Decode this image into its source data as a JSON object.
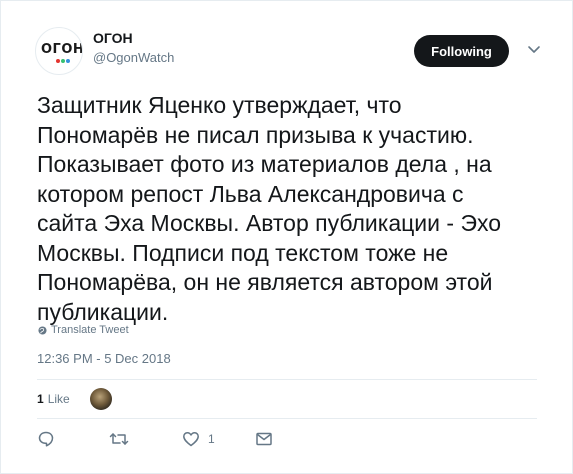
{
  "account": {
    "display_name": "ОГОН",
    "screen_name": "@OgonWatch",
    "avatar_text": "ОГОН"
  },
  "header": {
    "follow_label": "Following"
  },
  "tweet": {
    "text": "Защитник Яценко утверждает, что\nПономарёв не писал призыва к участию.\nПоказывает фото из материалов дела , на\nкотором репост Льва Александровича с\nсайта Эха Москвы. Автор публикации - Эхо\nМосквы. Подписи под текстом тоже не\nПономарёва, он не является автором этой\nпубликации.",
    "translate_label": "Translate Tweet",
    "timestamp": "12:36 PM - 5 Dec 2018"
  },
  "stats": {
    "likes_count": "1",
    "likes_label": "Like"
  },
  "actions": {
    "reply_count": "",
    "retweet_count": "",
    "like_count": "1"
  },
  "icons": {
    "reply": "reply-icon",
    "retweet": "retweet-icon",
    "like": "heart-icon",
    "dm": "envelope-icon",
    "caret": "chevron-down-icon",
    "globe": "globe-icon"
  },
  "colors": {
    "follow_bg": "#14171a",
    "muted_text": "#657786",
    "divider": "#e6ecf0",
    "avatar_dots": [
      "#e3342f",
      "#38c172",
      "#3490dc"
    ]
  }
}
